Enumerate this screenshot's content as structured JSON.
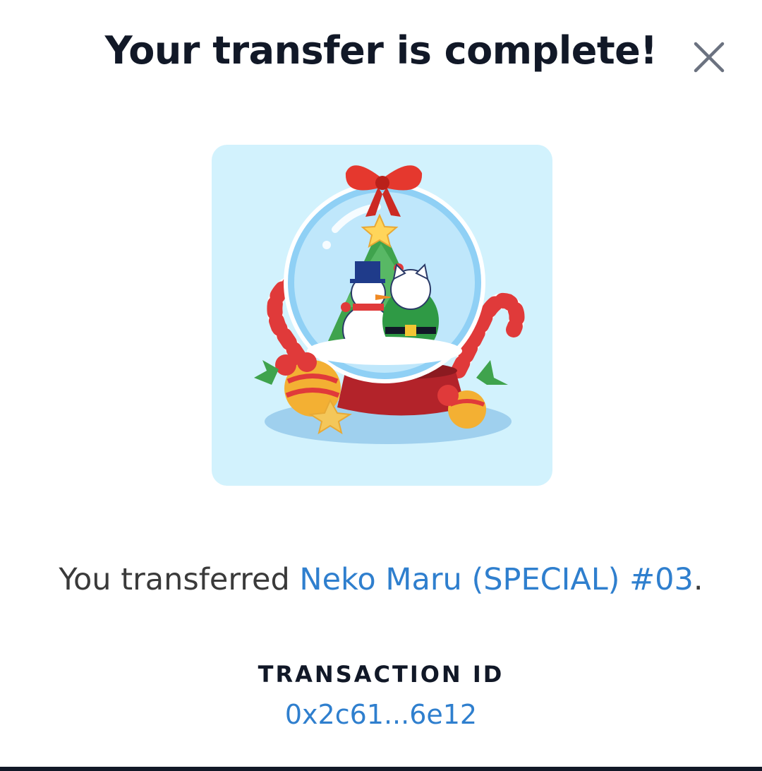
{
  "modal": {
    "title": "Your transfer is complete!",
    "close_icon": "close-icon"
  },
  "nft": {
    "image_description_icon": "snow-globe-image",
    "background_color": "#d2f2fd"
  },
  "message": {
    "prefix": "You transferred ",
    "nft_name": "Neko Maru (SPECIAL) #03",
    "suffix": "."
  },
  "transaction": {
    "label": "TRANSACTION ID",
    "id": "0x2c61...6e12"
  },
  "colors": {
    "link": "#2f7fce",
    "title": "#111827",
    "body_text": "#3a3a3a"
  }
}
